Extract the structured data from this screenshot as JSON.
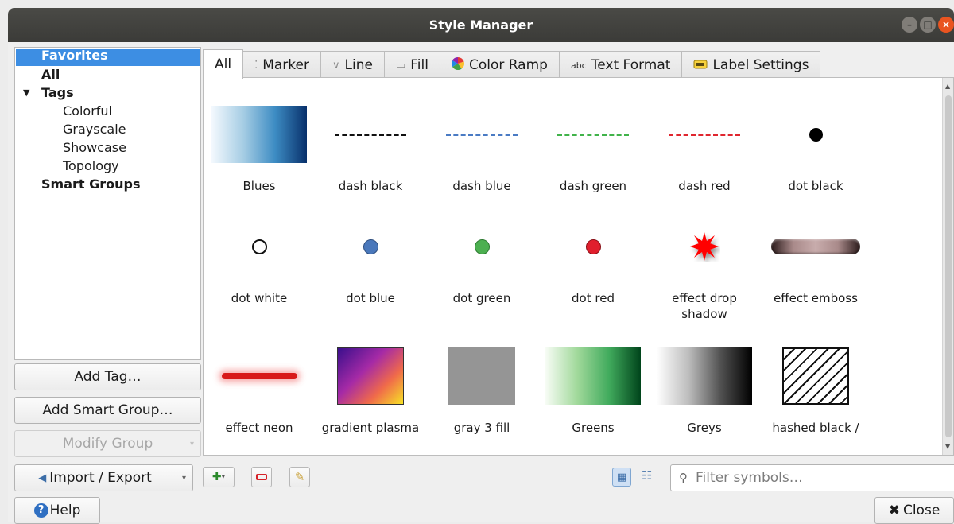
{
  "window": {
    "title": "Style Manager",
    "controls": [
      "–",
      "□",
      "×"
    ]
  },
  "tree": {
    "items": [
      {
        "label": "Favorites"
      },
      {
        "label": "All"
      },
      {
        "label": "Tags"
      },
      {
        "label": "Colorful"
      },
      {
        "label": "Grayscale"
      },
      {
        "label": "Showcase"
      },
      {
        "label": "Topology"
      },
      {
        "label": "Smart Groups"
      }
    ]
  },
  "buttons": {
    "add_tag": "Add Tag…",
    "add_smart_group": "Add Smart Group…",
    "modify_group": "Modify Group",
    "import_export": "Import / Export",
    "help": "Help",
    "close": "Close"
  },
  "tabs": [
    {
      "label": "All",
      "icon": ""
    },
    {
      "label": "Marker",
      "icon": "marker-icon"
    },
    {
      "label": "Line",
      "icon": "line-icon"
    },
    {
      "label": "Fill",
      "icon": "fill-icon"
    },
    {
      "label": "Color Ramp",
      "icon": "color-ramp-icon"
    },
    {
      "label": "Text Format",
      "icon": "abc"
    },
    {
      "label": "Label Settings",
      "icon": "label-icon"
    }
  ],
  "symbols": [
    {
      "name": "Blues"
    },
    {
      "name": "dash  black"
    },
    {
      "name": "dash blue"
    },
    {
      "name": "dash green"
    },
    {
      "name": "dash red"
    },
    {
      "name": "dot  black"
    },
    {
      "name": "dot  white"
    },
    {
      "name": "dot blue"
    },
    {
      "name": "dot green"
    },
    {
      "name": "dot red"
    },
    {
      "name": "effect drop shadow"
    },
    {
      "name": "effect emboss"
    },
    {
      "name": "effect neon"
    },
    {
      "name": "gradient plasma"
    },
    {
      "name": "gray 3 fill"
    },
    {
      "name": "Greens"
    },
    {
      "name": "Greys"
    },
    {
      "name": "hashed black /"
    }
  ],
  "filter": {
    "placeholder": "Filter symbols…"
  },
  "colors": {
    "selection": "#3d8ee3",
    "titlebar": "#3b3b38",
    "close_accent": "#e95420"
  }
}
